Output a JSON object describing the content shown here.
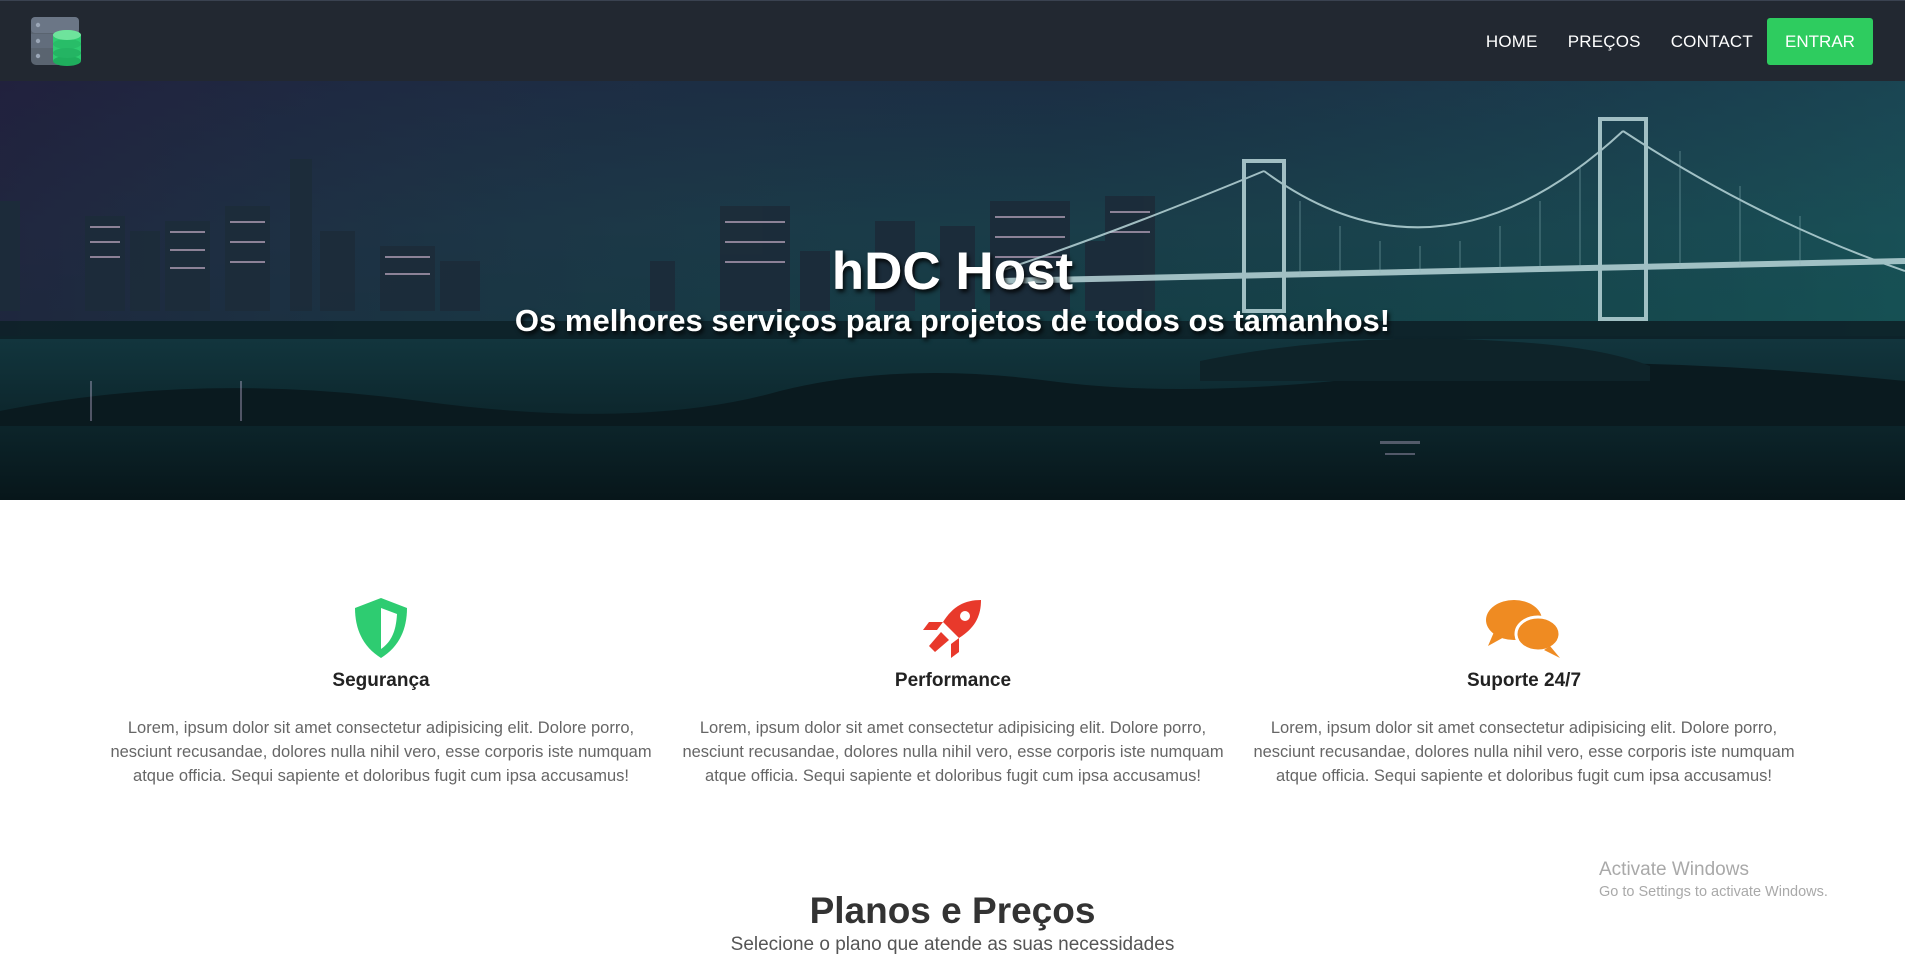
{
  "header": {
    "logo_icon": "database-server-icon",
    "nav": [
      "HOME",
      "PREÇOS",
      "CONTACT"
    ],
    "cta_label": "ENTRAR",
    "colors": {
      "bar": "#222831",
      "cta": "#2ecc5f"
    }
  },
  "hero": {
    "title": "hDC Host",
    "subtitle": "Os melhores serviços para projetos de todos os tamanhos!",
    "background": "night-city-bridge-photo"
  },
  "features": [
    {
      "icon": "shield-icon",
      "color": "#2ecc71",
      "title": "Segurança",
      "text": "Lorem, ipsum dolor sit amet consectetur adipisicing elit. Dolore porro, nesciunt recusandae, dolores nulla nihil vero, esse corporis iste numquam atque officia. Sequi sapiente et doloribus fugit cum ipsa accusamus!"
    },
    {
      "icon": "rocket-icon",
      "color": "#e8392b",
      "title": "Performance",
      "text": "Lorem, ipsum dolor sit amet consectetur adipisicing elit. Dolore porro, nesciunt recusandae, dolores nulla nihil vero, esse corporis iste numquam atque officia. Sequi sapiente et doloribus fugit cum ipsa accusamus!"
    },
    {
      "icon": "chat-bubbles-icon",
      "color": "#ef8b22",
      "title": "Suporte 24/7",
      "text": "Lorem, ipsum dolor sit amet consectetur adipisicing elit. Dolore porro, nesciunt recusandae, dolores nulla nihil vero, esse corporis iste numquam atque officia. Sequi sapiente et doloribus fugit cum ipsa accusamus!"
    }
  ],
  "pricing": {
    "title": "Planos e Preços",
    "subtitle": "Selecione o plano que atende as suas necessidades"
  },
  "watermark": {
    "line1": "Activate Windows",
    "line2": "Go to Settings to activate Windows."
  }
}
